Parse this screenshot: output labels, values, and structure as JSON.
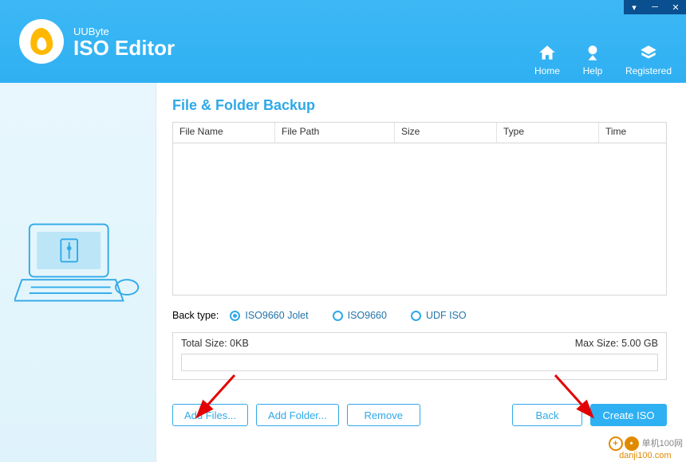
{
  "app": {
    "brand_small": "UUByte",
    "brand_big": "ISO Editor"
  },
  "nav": {
    "home": "Home",
    "help": "Help",
    "registered": "Registered"
  },
  "page": {
    "title": "File & Folder Backup"
  },
  "table": {
    "columns": {
      "name": "File Name",
      "path": "File Path",
      "size": "Size",
      "type": "Type",
      "time": "Time"
    }
  },
  "back_type": {
    "label": "Back type:",
    "options": {
      "iso9660_jolet": "ISO9660 Jolet",
      "iso9660": "ISO9660",
      "udf_iso": "UDF ISO"
    },
    "selected": "iso9660_jolet"
  },
  "size": {
    "total_label": "Total Size:",
    "total_value": "0KB",
    "max_label": "Max Size:",
    "max_value": "5.00 GB"
  },
  "buttons": {
    "add_files": "Add Files...",
    "add_folder": "Add Folder...",
    "remove": "Remove",
    "back": "Back",
    "create_iso": "Create ISO"
  },
  "watermark": {
    "line1": "单机100网",
    "line2": "danji100.com"
  }
}
